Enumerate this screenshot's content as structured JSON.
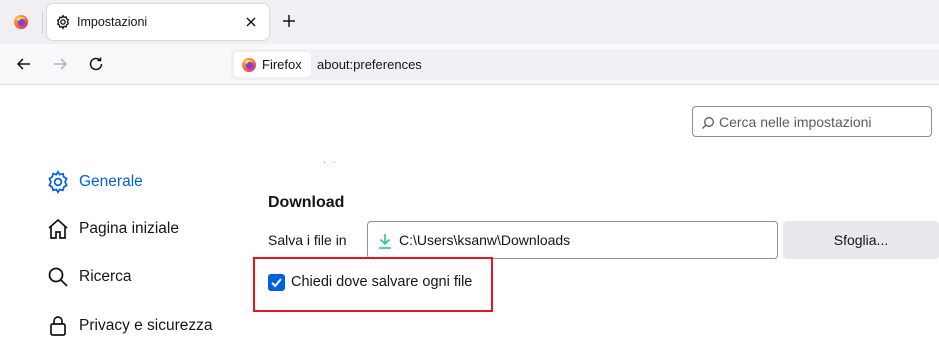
{
  "tabs": [
    {
      "label": "Impostazioni",
      "icon": "gear-icon",
      "active": true
    }
  ],
  "urlbar": {
    "identity_label": "Firefox",
    "url": "about:preferences"
  },
  "search": {
    "placeholder": "Cerca nelle impostazioni"
  },
  "sidebar": {
    "items": [
      {
        "label": "Generale",
        "icon": "gear-icon",
        "active": true
      },
      {
        "label": "Pagina iniziale",
        "icon": "home-icon"
      },
      {
        "label": "Ricerca",
        "icon": "search-icon"
      },
      {
        "label": "Privacy e sicurezza",
        "icon": "lock-icon"
      }
    ]
  },
  "download": {
    "title": "Download",
    "save_label": "Salva i file in",
    "path": "C:\\Users\\ksanw\\Downloads",
    "browse_label": "Sfoglia...",
    "ask_label": "Chiedi dove salvare ogni file",
    "ask_checked": true
  },
  "colors": {
    "accent": "#0061e0",
    "highlight": "#e8141f"
  }
}
